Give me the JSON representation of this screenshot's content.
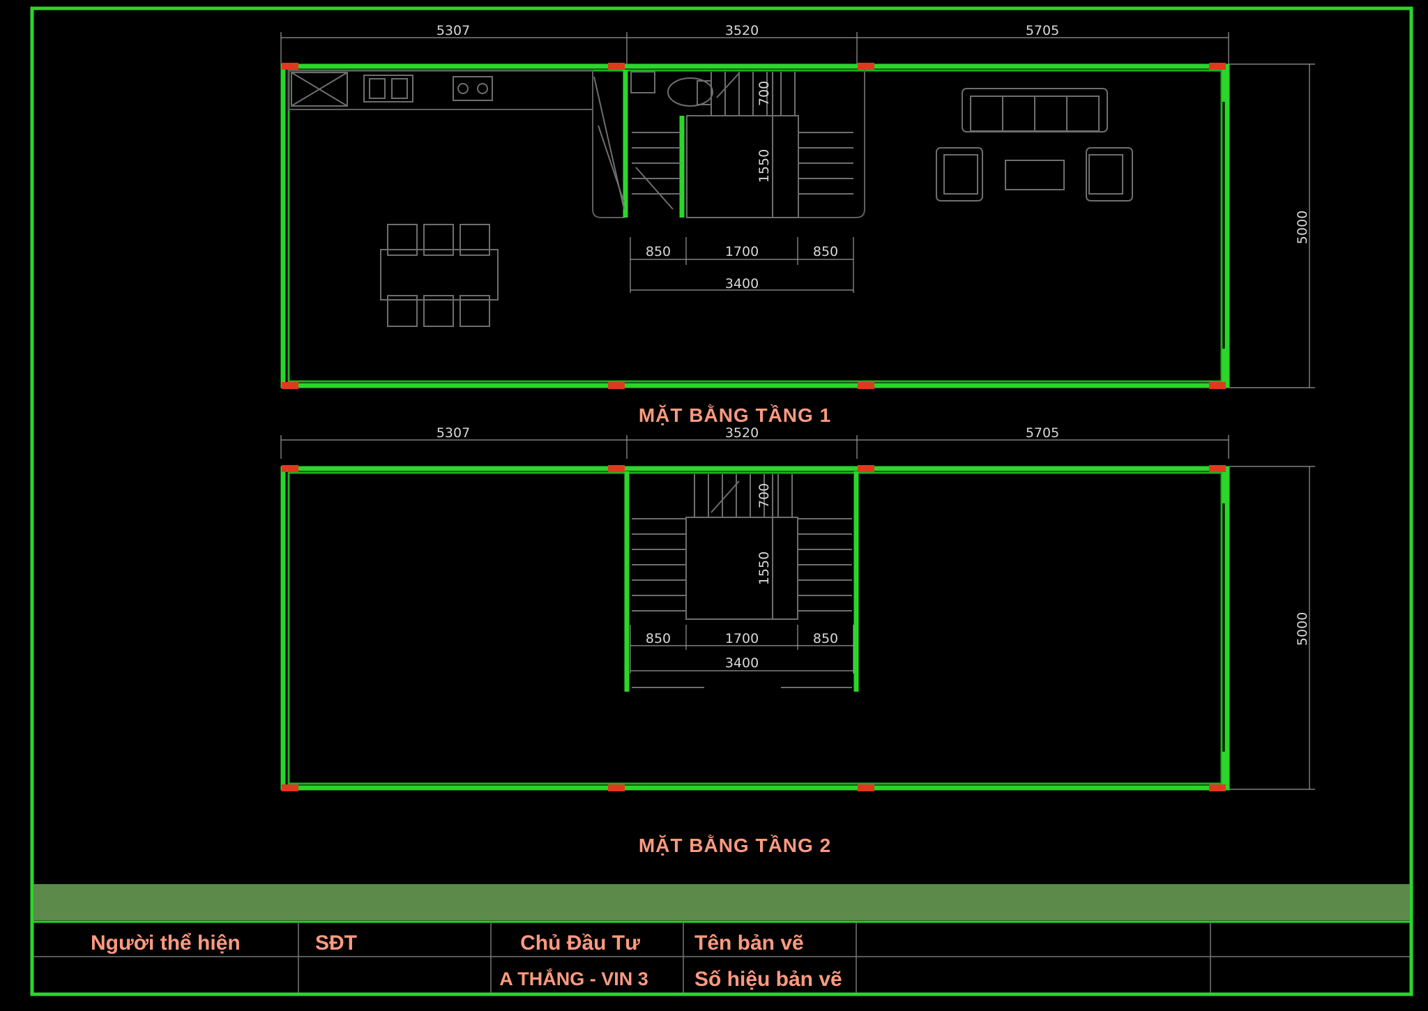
{
  "floor1": {
    "title": "MẶT BẰNG TẦNG 1",
    "top_dims": [
      "5307",
      "3520",
      "5705"
    ],
    "side_dim": "5000",
    "stair_run": "700",
    "stair_landing": "1550",
    "stair_widths": [
      "850",
      "1700",
      "850"
    ],
    "stair_total": "3400"
  },
  "floor2": {
    "title": "MẶT BẰNG TẦNG 2",
    "top_dims": [
      "5307",
      "3520",
      "5705"
    ],
    "side_dim": "5000",
    "stair_run": "700",
    "stair_landing": "1550",
    "stair_widths": [
      "850",
      "1700",
      "850"
    ],
    "stair_total": "3400"
  },
  "title_block": {
    "performer_label": "Người thể hiện",
    "phone_label": "SĐT",
    "investor_label": "Chủ Đầu Tư",
    "investor_value": "A THẮNG - VIN 3",
    "drawing_name_label": "Tên bản vẽ",
    "drawing_number_label": "Số hiệu bản vẽ"
  },
  "colors": {
    "frame": "#2bd62b",
    "band": "#5b8a4a",
    "text_accent": "#ff9a80",
    "column": "#e03a1e"
  }
}
